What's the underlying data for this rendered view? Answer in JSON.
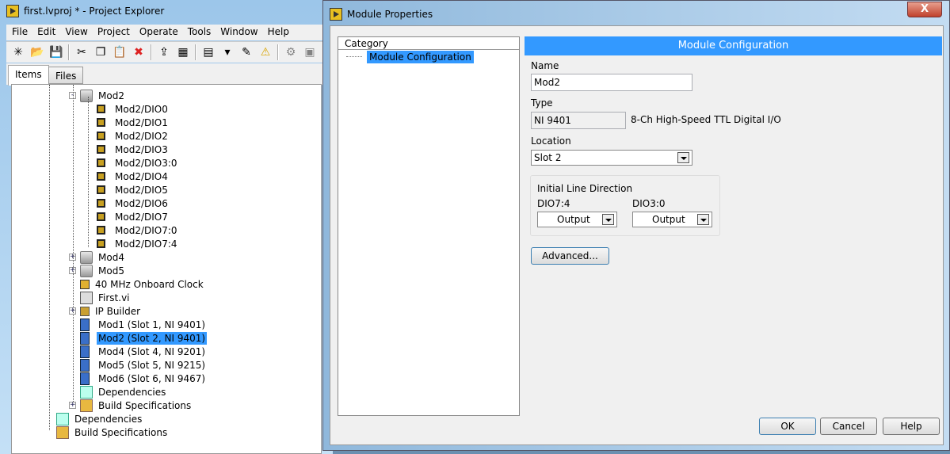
{
  "explorer": {
    "title": "first.lvproj * - Project Explorer",
    "menu": [
      "File",
      "Edit",
      "View",
      "Project",
      "Operate",
      "Tools",
      "Window",
      "Help"
    ],
    "toolbar_icons": [
      "new-icon",
      "open-icon",
      "save-all-icon",
      "cut-icon",
      "copy-icon",
      "paste-icon",
      "delete-icon",
      "deploy-icon",
      "save-target-icon",
      "view-icon",
      "dropdown-icon",
      "properties-icon",
      "warning-icon",
      "build-icon",
      "package-icon"
    ],
    "tabs": [
      "Items",
      "Files"
    ],
    "tree": [
      {
        "label": "Mod2",
        "icon": "folder",
        "level": 2,
        "exp": "-"
      },
      {
        "label": "Mod2/DIO0",
        "icon": "dio",
        "level": 3
      },
      {
        "label": "Mod2/DIO1",
        "icon": "dio",
        "level": 3
      },
      {
        "label": "Mod2/DIO2",
        "icon": "dio",
        "level": 3
      },
      {
        "label": "Mod2/DIO3",
        "icon": "dio",
        "level": 3
      },
      {
        "label": "Mod2/DIO3:0",
        "icon": "dio",
        "level": 3
      },
      {
        "label": "Mod2/DIO4",
        "icon": "dio",
        "level": 3
      },
      {
        "label": "Mod2/DIO5",
        "icon": "dio",
        "level": 3
      },
      {
        "label": "Mod2/DIO6",
        "icon": "dio",
        "level": 3
      },
      {
        "label": "Mod2/DIO7",
        "icon": "dio",
        "level": 3
      },
      {
        "label": "Mod2/DIO7:0",
        "icon": "dio",
        "level": 3
      },
      {
        "label": "Mod2/DIO7:4",
        "icon": "dio",
        "level": 3
      },
      {
        "label": "Mod4",
        "icon": "folder",
        "level": 2,
        "exp": "+"
      },
      {
        "label": "Mod5",
        "icon": "folder",
        "level": 2,
        "exp": "+"
      },
      {
        "label": "40 MHz Onboard Clock",
        "icon": "clock",
        "level": 2
      },
      {
        "label": "First.vi",
        "icon": "vi",
        "level": 2
      },
      {
        "label": "IP Builder",
        "icon": "ip",
        "level": 2,
        "exp": "+"
      },
      {
        "label": "Mod1 (Slot 1, NI 9401)",
        "icon": "mod",
        "level": 2
      },
      {
        "label": "Mod2 (Slot 2, NI 9401)",
        "icon": "mod",
        "level": 2,
        "selected": true
      },
      {
        "label": "Mod4 (Slot 4, NI 9201)",
        "icon": "mod",
        "level": 2
      },
      {
        "label": "Mod5 (Slot 5, NI 9215)",
        "icon": "mod",
        "level": 2
      },
      {
        "label": "Mod6 (Slot 6, NI 9467)",
        "icon": "mod",
        "level": 2
      },
      {
        "label": "Dependencies",
        "icon": "dep",
        "level": 2
      },
      {
        "label": "Build Specifications",
        "icon": "build",
        "level": 2,
        "exp": "+"
      },
      {
        "label": "Dependencies",
        "icon": "dep",
        "level": 1
      },
      {
        "label": "Build Specifications",
        "icon": "build",
        "level": 1
      }
    ]
  },
  "dialog": {
    "title": "Module Properties",
    "close": "X",
    "category_header": "Category",
    "category_item": "Module Configuration",
    "section_title": "Module Configuration",
    "name_label": "Name",
    "name_value": "Mod2",
    "type_label": "Type",
    "type_value": "NI 9401",
    "type_desc": "8-Ch High-Speed TTL Digital I/O",
    "location_label": "Location",
    "location_value": "Slot 2",
    "ild_title": "Initial Line Direction",
    "dio74_label": "DIO7:4",
    "dio74_value": "Output",
    "dio30_label": "DIO3:0",
    "dio30_value": "Output",
    "advanced": "Advanced...",
    "ok": "OK",
    "cancel": "Cancel",
    "help": "Help"
  }
}
